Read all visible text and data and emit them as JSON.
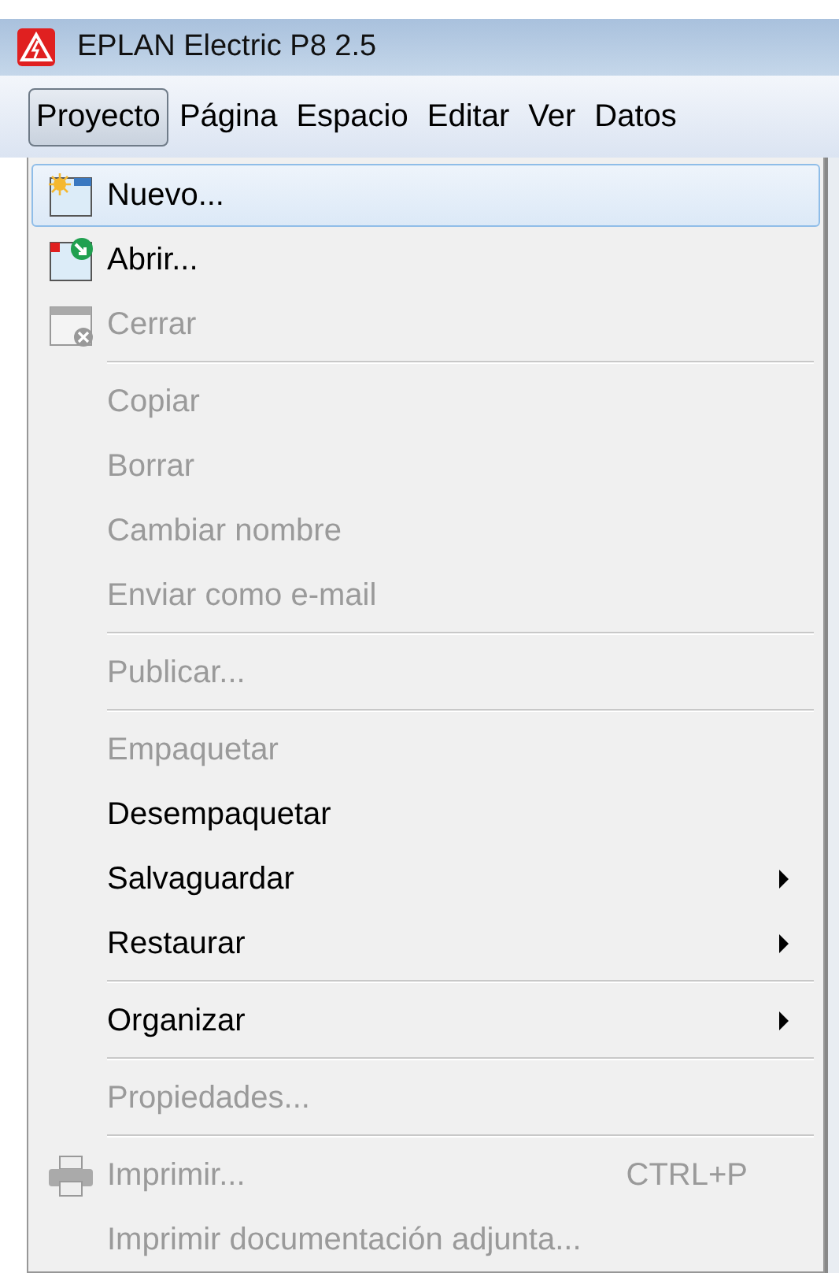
{
  "window": {
    "title": "EPLAN Electric P8 2.5"
  },
  "menu_bar": [
    {
      "label": "Proyecto",
      "selected": true
    },
    {
      "label": "Página",
      "selected": false
    },
    {
      "label": "Espacio",
      "selected": false
    },
    {
      "label": "Editar",
      "selected": false
    },
    {
      "label": "Ver",
      "selected": false
    },
    {
      "label": "Datos",
      "selected": false
    }
  ],
  "menu": [
    {
      "kind": "new",
      "label": "Nuevo...",
      "disabled": false,
      "selected": true
    },
    {
      "kind": "open",
      "label": "Abrir...",
      "disabled": false,
      "selected": false
    },
    {
      "kind": "close",
      "label": "Cerrar",
      "disabled": true,
      "selected": false
    },
    {
      "kind": "separator"
    },
    {
      "kind": "item",
      "label": "Copiar",
      "disabled": true,
      "selected": false
    },
    {
      "kind": "item",
      "label": "Borrar",
      "disabled": true,
      "selected": false
    },
    {
      "kind": "item",
      "label": "Cambiar nombre",
      "disabled": true,
      "selected": false
    },
    {
      "kind": "item",
      "label": "Enviar como e-mail",
      "disabled": true,
      "selected": false
    },
    {
      "kind": "separator"
    },
    {
      "kind": "item",
      "label": "Publicar...",
      "disabled": true,
      "selected": false
    },
    {
      "kind": "separator"
    },
    {
      "kind": "item",
      "label": "Empaquetar",
      "disabled": true,
      "selected": false
    },
    {
      "kind": "item",
      "label": "Desempaquetar",
      "disabled": false,
      "selected": false
    },
    {
      "kind": "item",
      "label": "Salvaguardar",
      "disabled": false,
      "selected": false,
      "submenu": true
    },
    {
      "kind": "item",
      "label": "Restaurar",
      "disabled": false,
      "selected": false,
      "submenu": true
    },
    {
      "kind": "separator"
    },
    {
      "kind": "item",
      "label": "Organizar",
      "disabled": false,
      "selected": false,
      "submenu": true
    },
    {
      "kind": "separator"
    },
    {
      "kind": "item",
      "label": "Propiedades...",
      "disabled": true,
      "selected": false
    },
    {
      "kind": "separator"
    },
    {
      "kind": "print",
      "label": "Imprimir...",
      "disabled": true,
      "selected": false,
      "shortcut": "CTRL+P"
    },
    {
      "kind": "item",
      "label": "Imprimir documentación adjunta...",
      "disabled": true,
      "selected": false
    }
  ]
}
